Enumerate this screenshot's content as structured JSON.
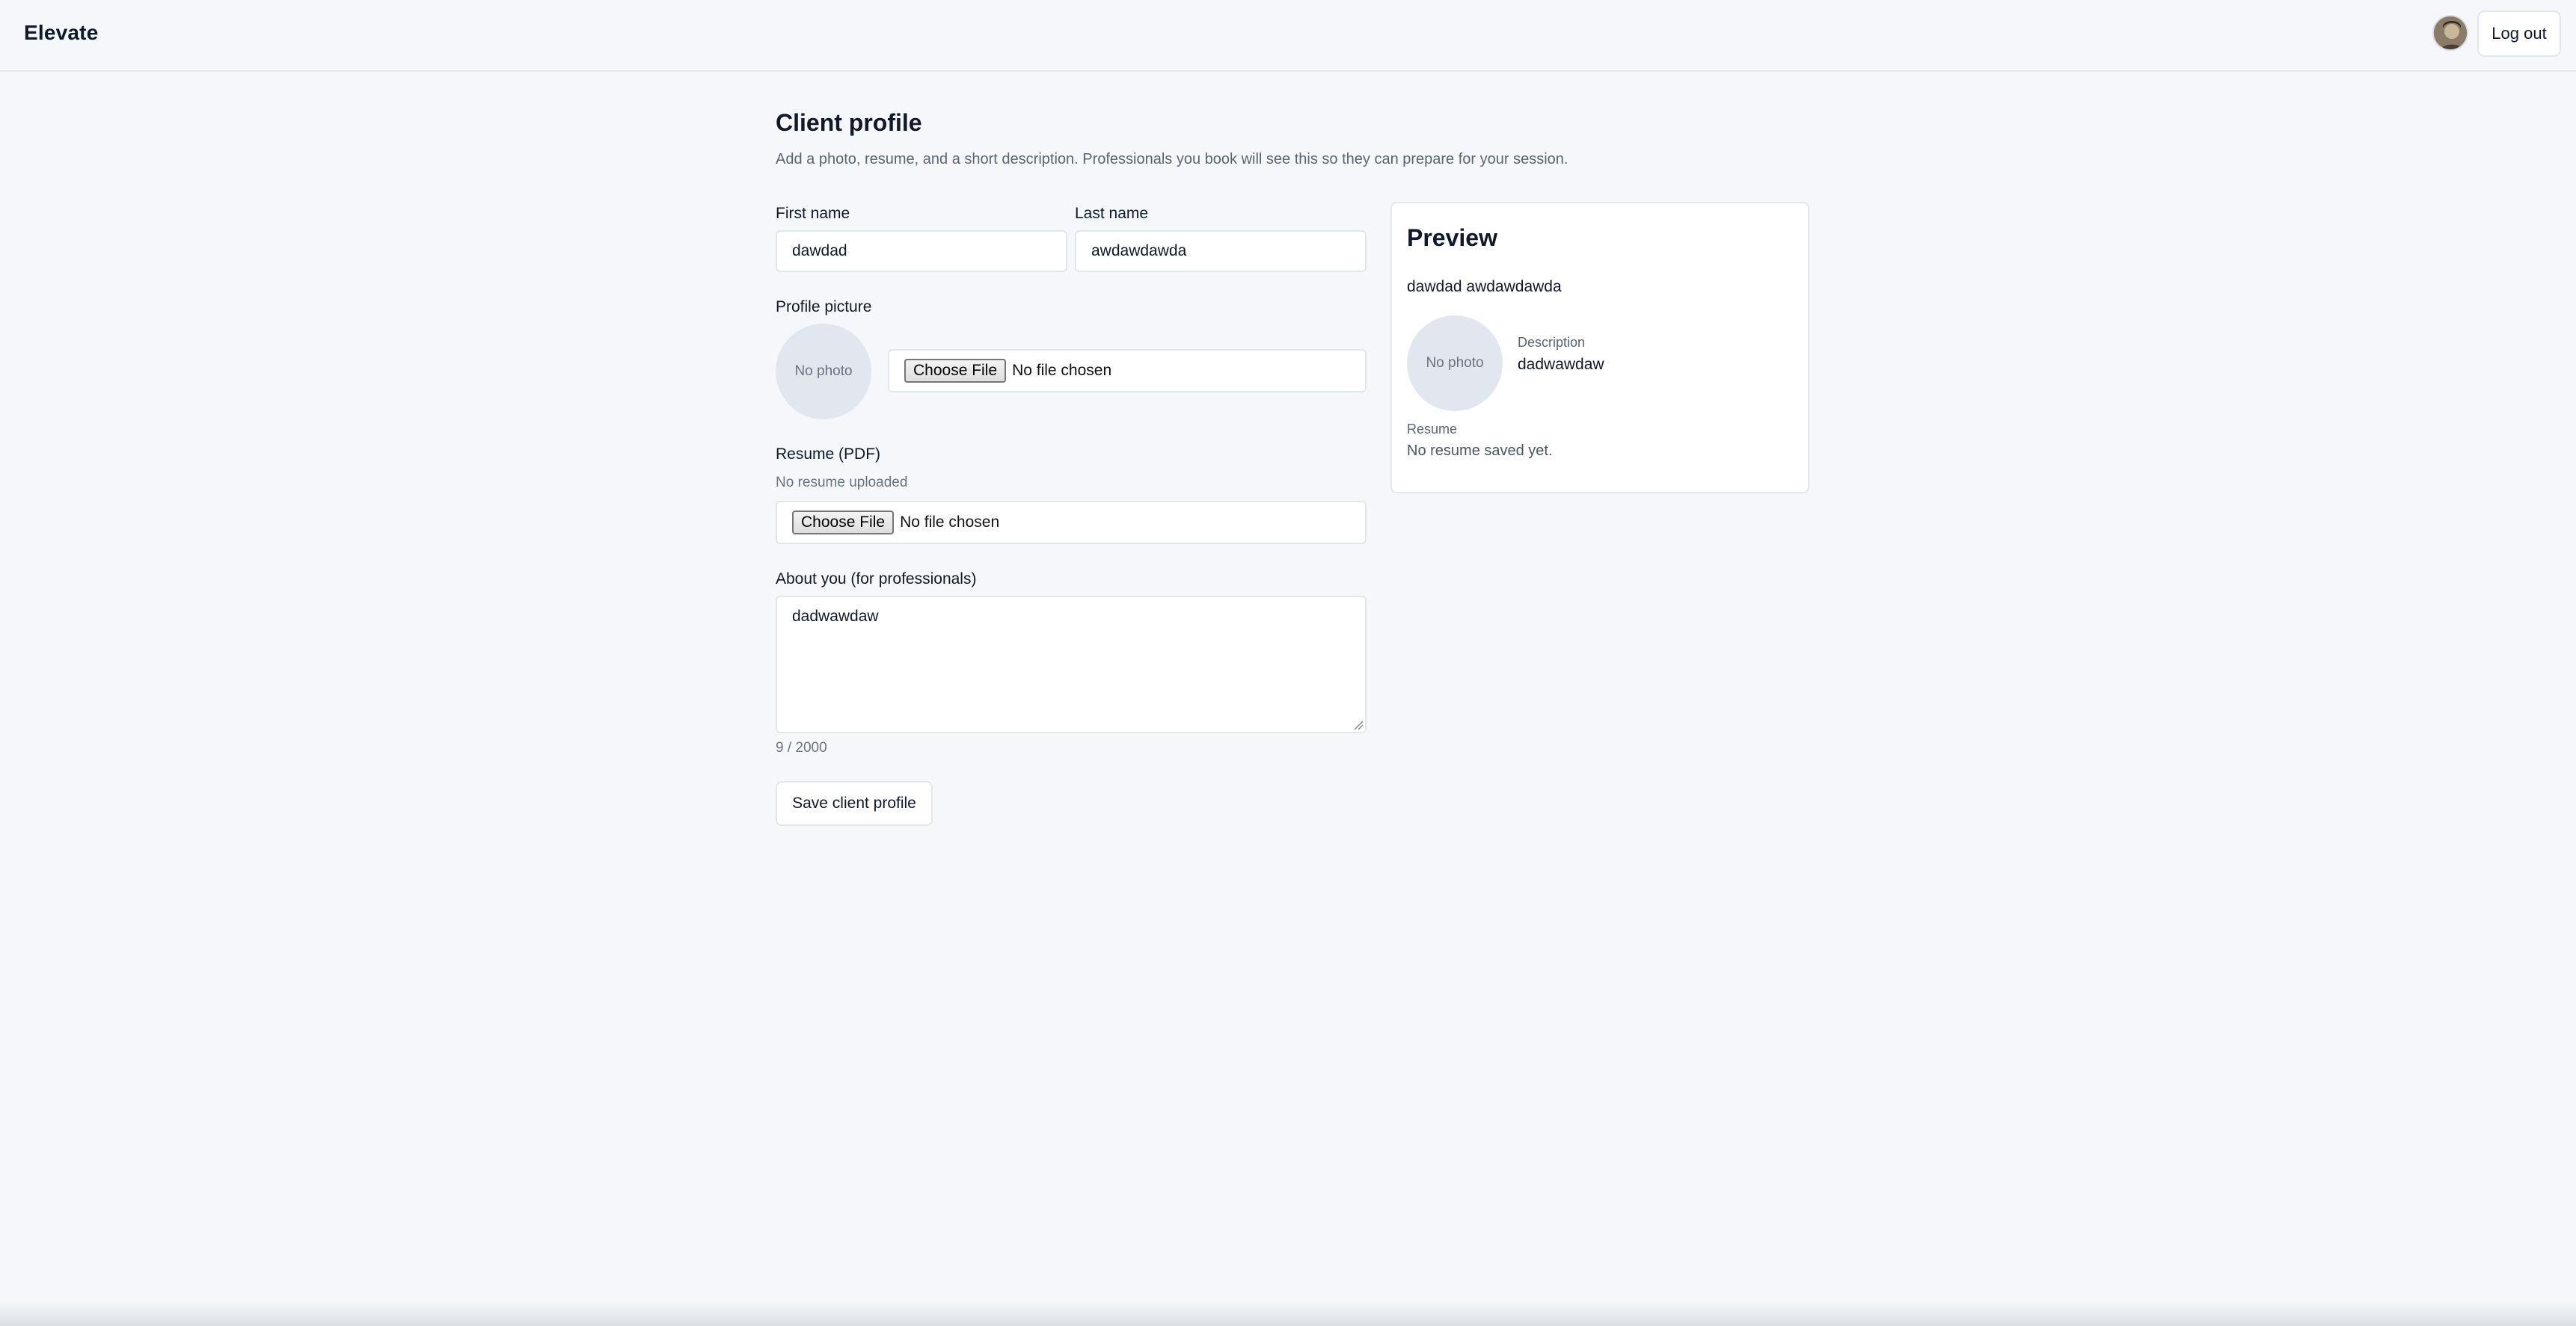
{
  "header": {
    "brand": "Elevate",
    "logout_label": "Log out",
    "avatar_icon": "user-avatar"
  },
  "page": {
    "title": "Client profile",
    "subtitle": "Add a photo, resume, and a short description. Professionals you book will see this so they can prepare for your session."
  },
  "form": {
    "first_name_label": "First name",
    "first_name_value": "dawdad",
    "last_name_label": "Last name",
    "last_name_value": "awdawdawda",
    "profile_picture_label": "Profile picture",
    "no_photo": "No photo",
    "choose_file": "Choose File",
    "no_file_chosen": "No file chosen",
    "resume_label": "Resume (PDF)",
    "resume_status": "No resume uploaded",
    "about_label": "About you (for professionals)",
    "about_value": "dadwawdaw",
    "char_count": "9 / 2000",
    "save_label": "Save client profile"
  },
  "preview": {
    "title": "Preview",
    "name": "dawdad awdawdawda",
    "no_photo": "No photo",
    "description_label": "Description",
    "description_value": "dadwawdaw",
    "resume_label": "Resume",
    "resume_value": "No resume saved yet."
  }
}
